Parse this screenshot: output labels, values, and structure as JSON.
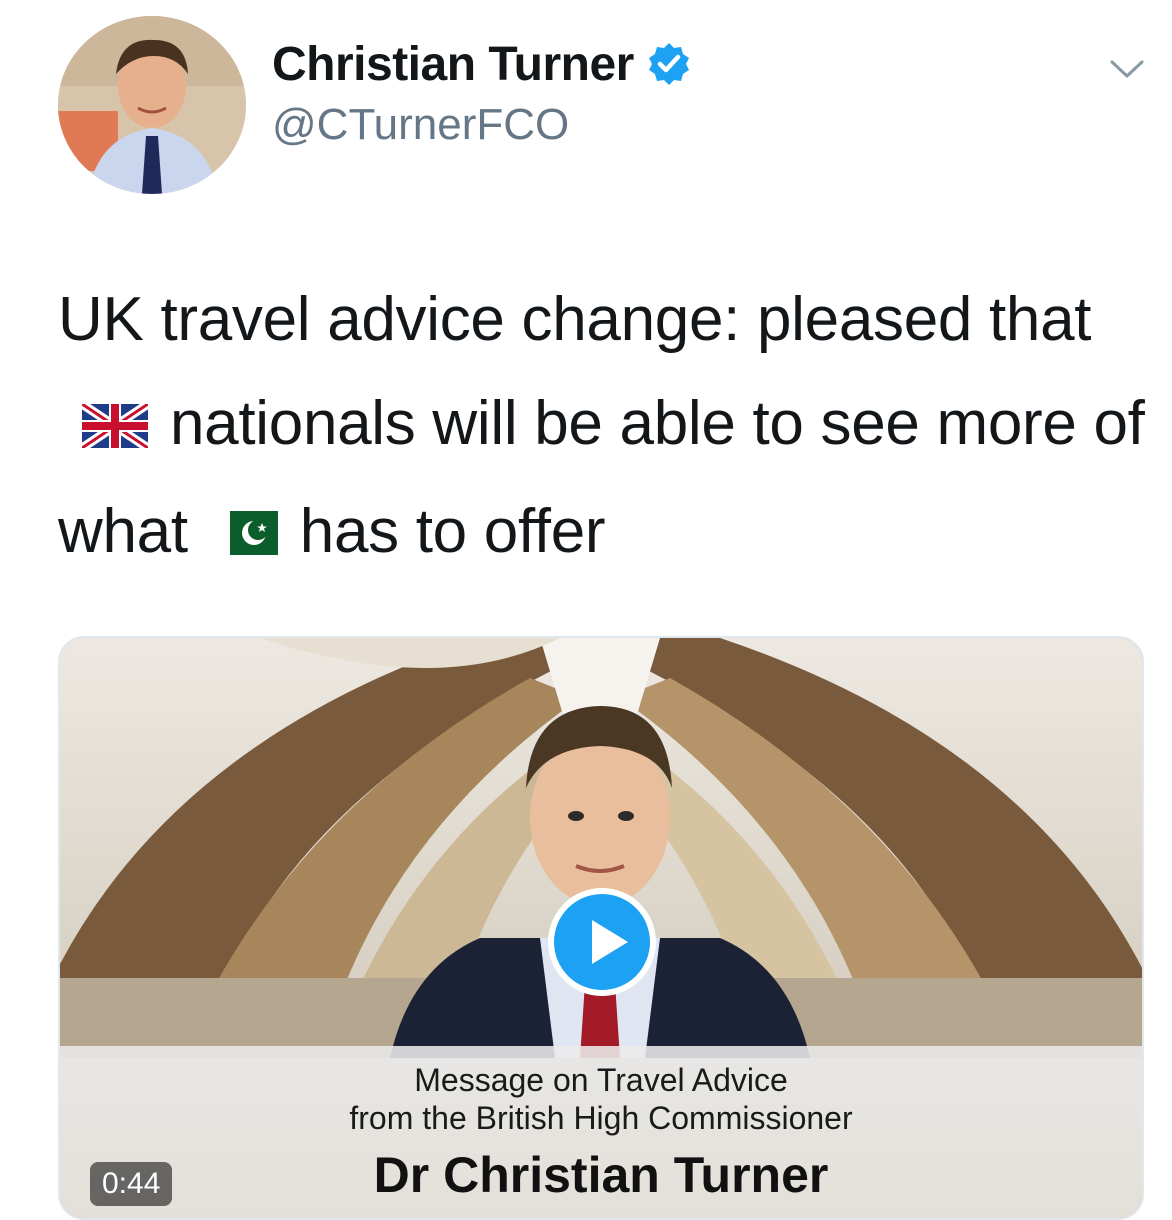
{
  "author": {
    "display_name": "Christian Turner",
    "handle": "@CTurnerFCO",
    "verified": true,
    "verified_color": "#1da1f2"
  },
  "menu": {
    "icon": "chevron-down-icon"
  },
  "tweet": {
    "text_part1": "UK travel advice change: pleased that",
    "flag1": "united-kingdom-flag-emoji",
    "text_part2": "nationals will be able to see more of what",
    "flag2": "pakistan-flag-emoji",
    "text_part3": "has to offer"
  },
  "media": {
    "type": "video",
    "caption_line1": "Message on Travel Advice",
    "caption_line2": "from the British High Commissioner",
    "caption_name": "Dr Christian Turner",
    "duration": "0:44",
    "play_icon": "play-icon",
    "accent_color": "#1da1f2"
  }
}
